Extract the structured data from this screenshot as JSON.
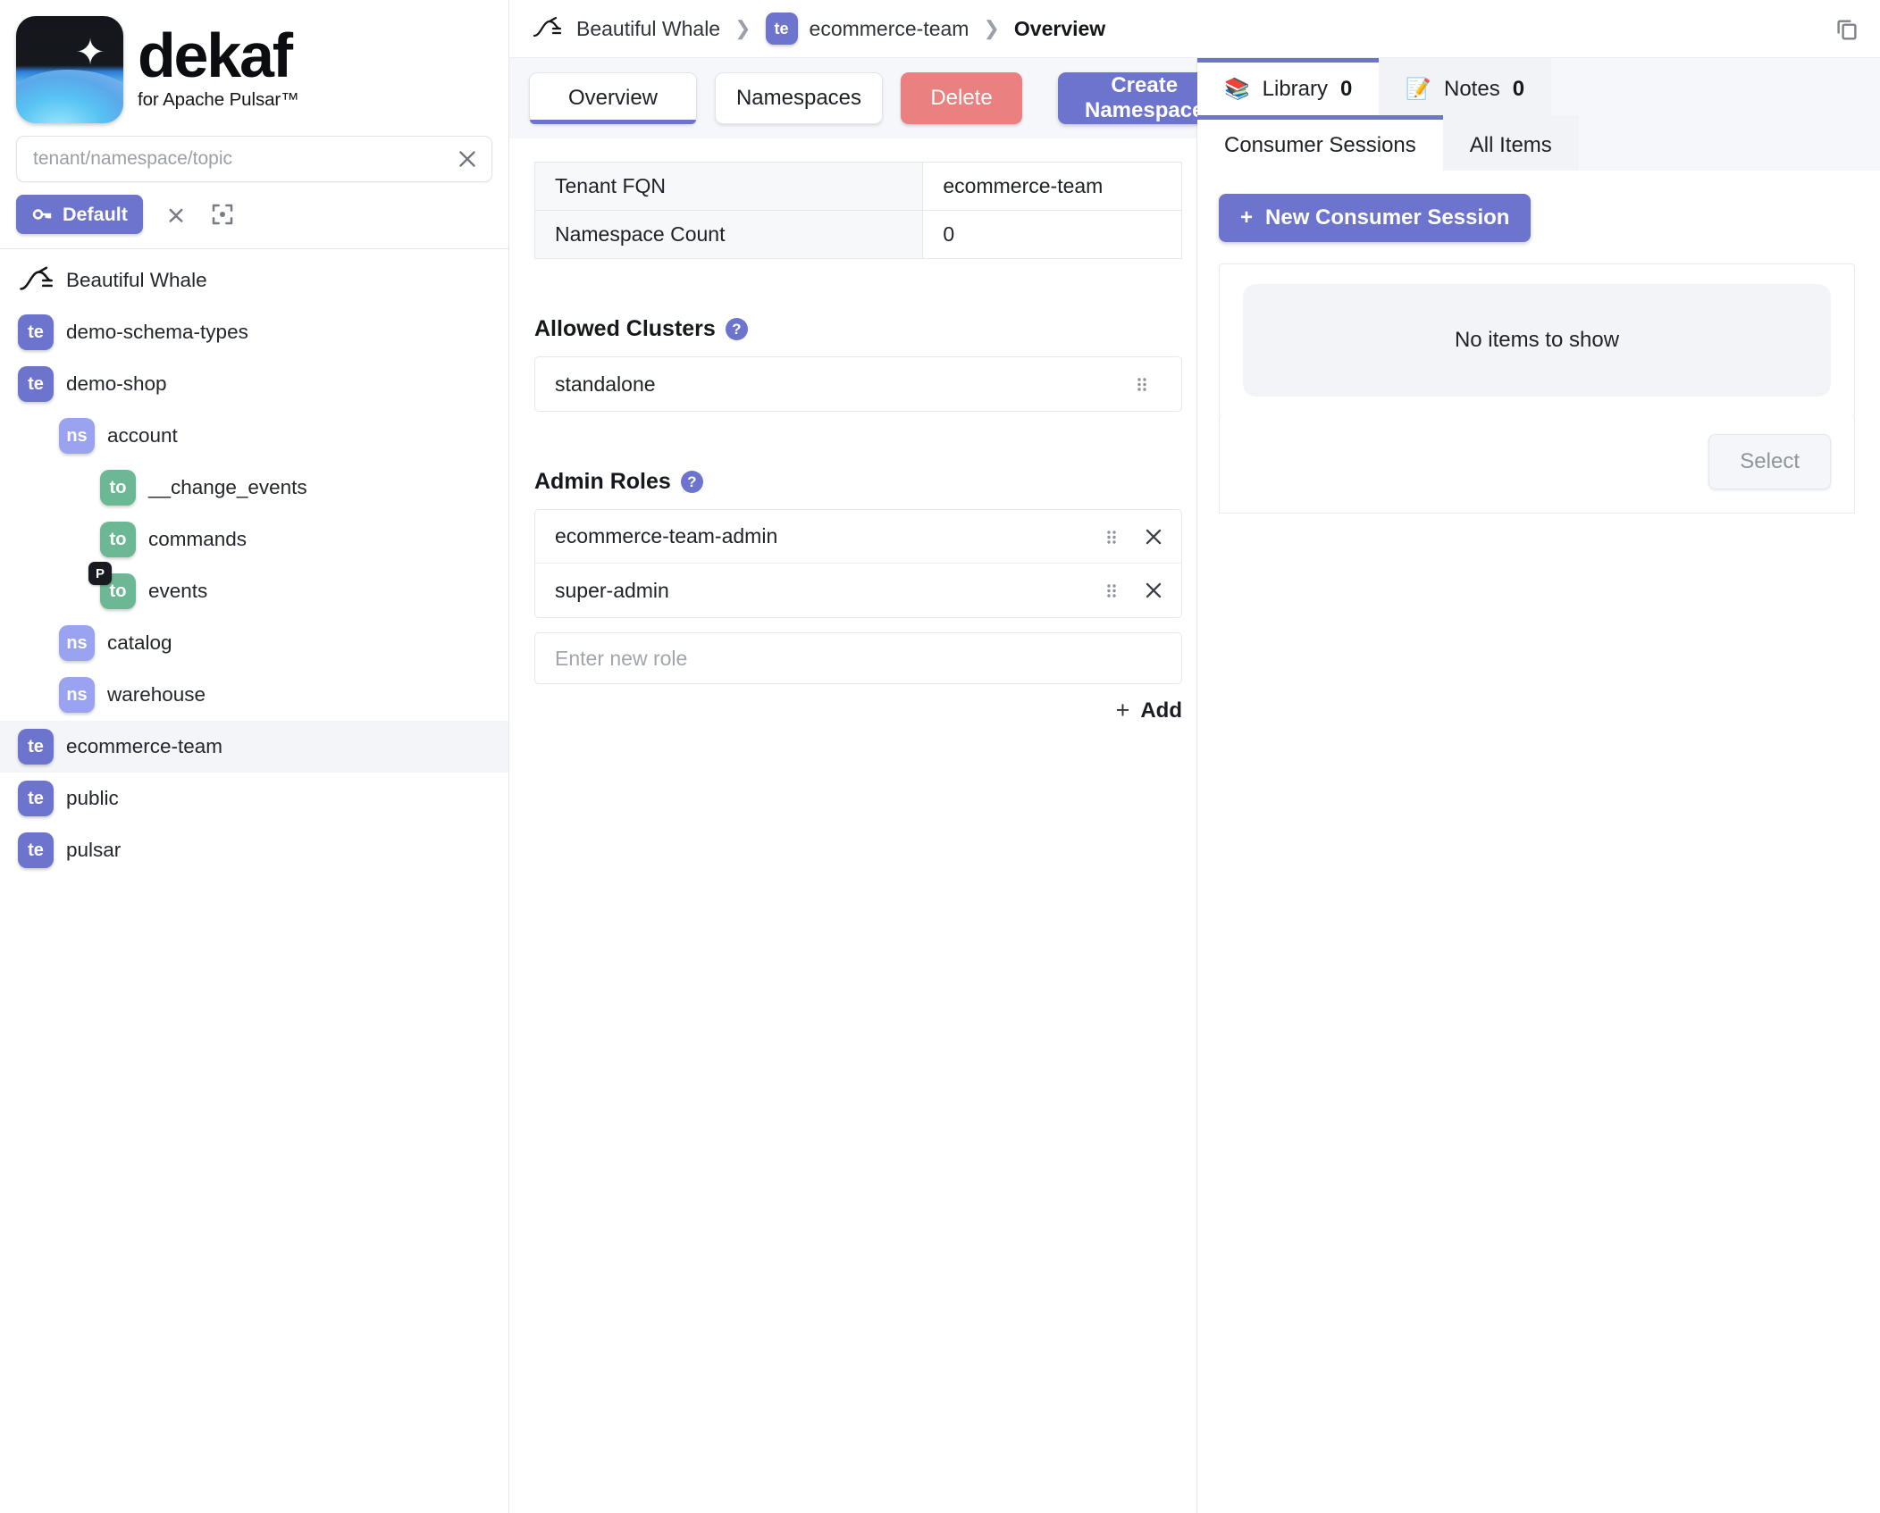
{
  "brand": {
    "name": "dekaf",
    "tagline": "for Apache Pulsar™",
    "logo_icon": "whale-night-logo",
    "accent_color": "#6d74cd"
  },
  "search": {
    "placeholder": "tenant/namespace/topic",
    "value": "",
    "clear_icon": "close-x-icon"
  },
  "sidebar_toolbar": {
    "profile_label": "Default",
    "profile_icon": "key-icon",
    "collapse_icon": "collapse-all-icon",
    "focus_icon": "focus-target-icon"
  },
  "tree": {
    "items": [
      {
        "label": "Beautiful Whale",
        "kind": "cluster",
        "badge": "",
        "level": 1,
        "selected": false,
        "flag": ""
      },
      {
        "label": "demo-schema-types",
        "kind": "tenant",
        "badge": "te",
        "level": 1,
        "selected": false,
        "flag": ""
      },
      {
        "label": "demo-shop",
        "kind": "tenant",
        "badge": "te",
        "level": 1,
        "selected": false,
        "flag": ""
      },
      {
        "label": "account",
        "kind": "namespace",
        "badge": "ns",
        "level": 2,
        "selected": false,
        "flag": ""
      },
      {
        "label": "__change_events",
        "kind": "topic",
        "badge": "to",
        "level": 3,
        "selected": false,
        "flag": ""
      },
      {
        "label": "commands",
        "kind": "topic",
        "badge": "to",
        "level": 3,
        "selected": false,
        "flag": ""
      },
      {
        "label": "events",
        "kind": "topic",
        "badge": "to",
        "level": 3,
        "selected": false,
        "flag": "P"
      },
      {
        "label": "catalog",
        "kind": "namespace",
        "badge": "ns",
        "level": 2,
        "selected": false,
        "flag": ""
      },
      {
        "label": "warehouse",
        "kind": "namespace",
        "badge": "ns",
        "level": 2,
        "selected": false,
        "flag": ""
      },
      {
        "label": "ecommerce-team",
        "kind": "tenant",
        "badge": "te",
        "level": 1,
        "selected": true,
        "flag": ""
      },
      {
        "label": "public",
        "kind": "tenant",
        "badge": "te",
        "level": 1,
        "selected": false,
        "flag": ""
      },
      {
        "label": "pulsar",
        "kind": "tenant",
        "badge": "te",
        "level": 1,
        "selected": false,
        "flag": ""
      }
    ]
  },
  "breadcrumb": {
    "cluster": "Beautiful Whale",
    "tenant_badge": "te",
    "tenant": "ecommerce-team",
    "page": "Overview",
    "separator": "❯",
    "copy_icon": "copy-icon"
  },
  "actions": {
    "tab_overview": "Overview",
    "tab_namespaces": "Namespaces",
    "delete_label": "Delete",
    "create_namespace_label": "Create Namespace"
  },
  "overview_table": {
    "rows": [
      {
        "key": "Tenant FQN",
        "value": "ecommerce-team"
      },
      {
        "key": "Namespace Count",
        "value": "0"
      }
    ]
  },
  "allowed_clusters": {
    "title": "Allowed Clusters",
    "help_glyph": "?",
    "items": [
      "standalone"
    ]
  },
  "admin_roles": {
    "title": "Admin Roles",
    "help_glyph": "?",
    "items": [
      "ecommerce-team-admin",
      "super-admin"
    ],
    "new_role_placeholder": "Enter new role",
    "new_role_value": "",
    "add_label": "Add",
    "add_glyph": "+"
  },
  "right_panel": {
    "tabs": [
      {
        "label": "Library",
        "emoji": "📚",
        "count": "0",
        "active": true
      },
      {
        "label": "Notes",
        "emoji": "📝",
        "count": "0",
        "active": false
      }
    ],
    "subtabs": [
      {
        "label": "Consumer Sessions",
        "active": true
      },
      {
        "label": "All Items",
        "active": false
      }
    ],
    "new_session_label": "New Consumer Session",
    "new_session_glyph": "+",
    "empty_text": "No items to show",
    "select_label": "Select"
  }
}
